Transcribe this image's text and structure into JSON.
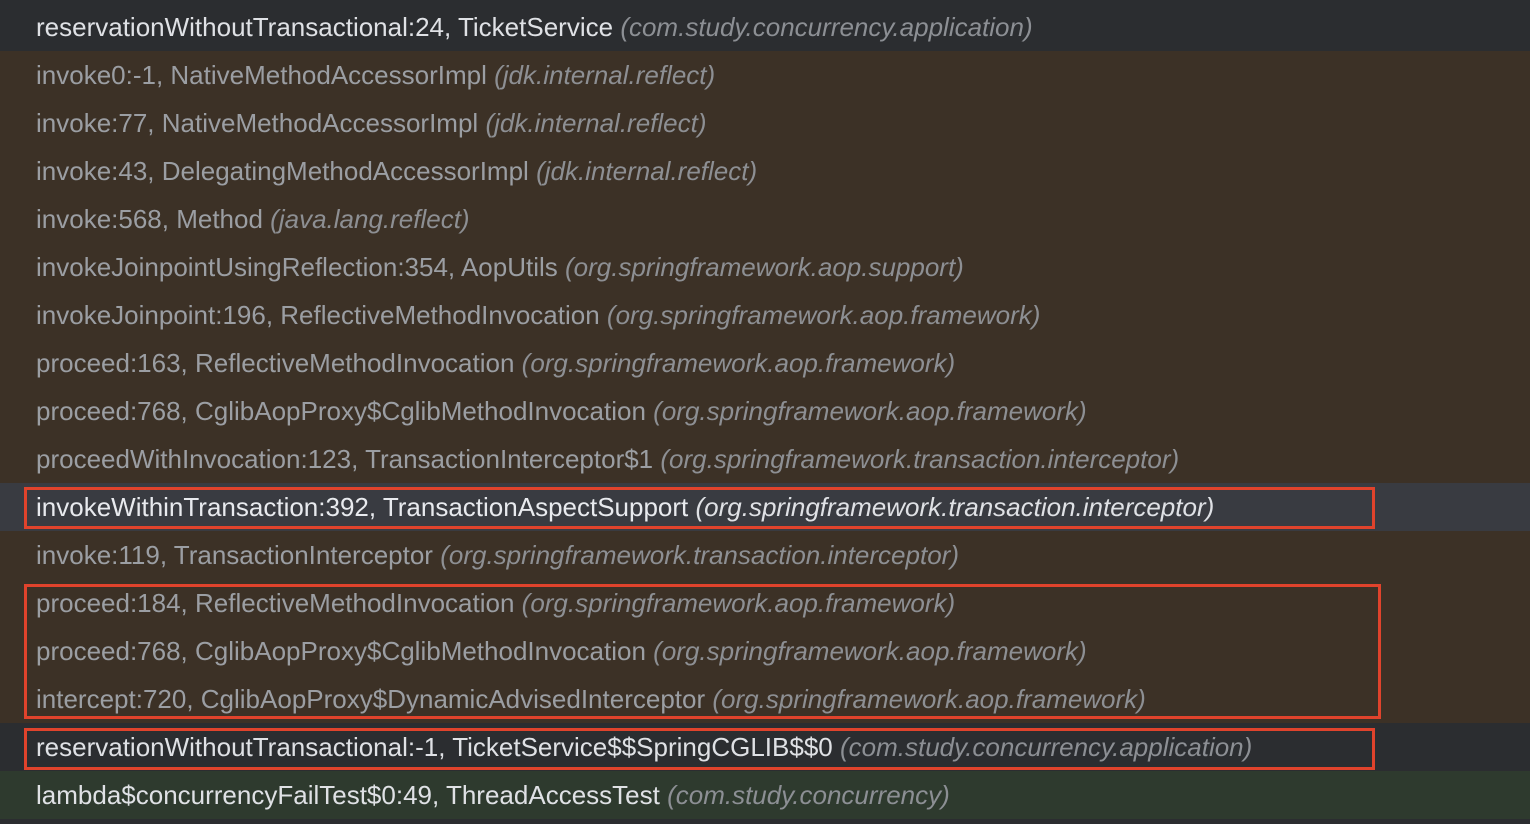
{
  "frames": [
    {
      "method": "reservationWithoutTransactional:24, TicketService",
      "package": "(com.study.concurrency.application)"
    },
    {
      "method": "invoke0:-1, NativeMethodAccessorImpl",
      "package": "(jdk.internal.reflect)"
    },
    {
      "method": "invoke:77, NativeMethodAccessorImpl",
      "package": "(jdk.internal.reflect)"
    },
    {
      "method": "invoke:43, DelegatingMethodAccessorImpl",
      "package": "(jdk.internal.reflect)"
    },
    {
      "method": "invoke:568, Method",
      "package": "(java.lang.reflect)"
    },
    {
      "method": "invokeJoinpointUsingReflection:354, AopUtils",
      "package": "(org.springframework.aop.support)"
    },
    {
      "method": "invokeJoinpoint:196, ReflectiveMethodInvocation",
      "package": "(org.springframework.aop.framework)"
    },
    {
      "method": "proceed:163, ReflectiveMethodInvocation",
      "package": "(org.springframework.aop.framework)"
    },
    {
      "method": "proceed:768, CglibAopProxy$CglibMethodInvocation",
      "package": "(org.springframework.aop.framework)"
    },
    {
      "method": "proceedWithInvocation:123, TransactionInterceptor$1",
      "package": "(org.springframework.transaction.interceptor)"
    },
    {
      "method": "invokeWithinTransaction:392, TransactionAspectSupport",
      "package": "(org.springframework.transaction.interceptor)"
    },
    {
      "method": "invoke:119, TransactionInterceptor",
      "package": "(org.springframework.transaction.interceptor)"
    },
    {
      "method": "proceed:184, ReflectiveMethodInvocation",
      "package": "(org.springframework.aop.framework)"
    },
    {
      "method": "proceed:768, CglibAopProxy$CglibMethodInvocation",
      "package": "(org.springframework.aop.framework)"
    },
    {
      "method": "intercept:720, CglibAopProxy$DynamicAdvisedInterceptor",
      "package": "(org.springframework.aop.framework)"
    },
    {
      "method": "reservationWithoutTransactional:-1, TicketService$$SpringCGLIB$$0",
      "package": "(com.study.concurrency.application)"
    },
    {
      "method": "lambda$concurrencyFailTest$0:49, ThreadAccessTest",
      "package": "(com.study.concurrency)"
    }
  ],
  "colors": {
    "background_current": "#2b2d30",
    "background_library": "#3c3126",
    "background_selected": "#393b41",
    "background_test": "#2e3a2e",
    "annotation_box": "#e0432c"
  }
}
